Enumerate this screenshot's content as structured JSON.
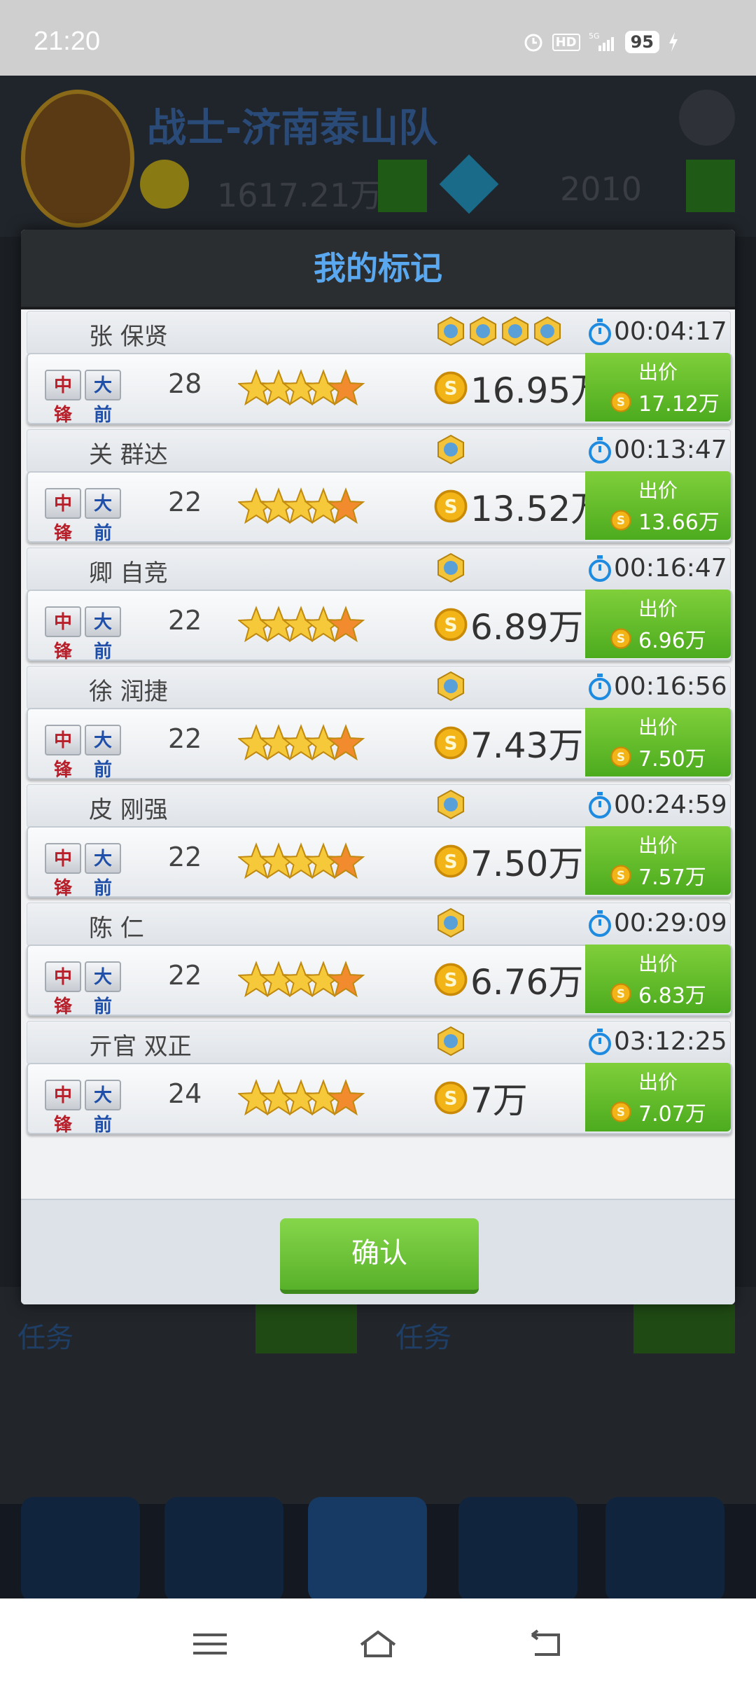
{
  "status_bar": {
    "time": "21:20",
    "battery": "95",
    "network": "5G",
    "hd": "HD"
  },
  "background": {
    "team_name": "战士-济南泰山队",
    "coins": "1617.21万",
    "gems": "2010",
    "panel_left_title": "任务",
    "panel_right_title": "任务"
  },
  "dialog": {
    "title": "我的标记",
    "confirm_label": "确认",
    "entries": [
      {
        "name": "张 保贤",
        "badge_count": 4,
        "timer": "00:04:17",
        "positions": [
          "中锋",
          "大前"
        ],
        "level": "28",
        "star_rating": 5,
        "price": "16.95万",
        "bid_label": "出价",
        "bid_price": "17.12万"
      },
      {
        "name": "关 群达",
        "badge_count": 1,
        "timer": "00:13:47",
        "positions": [
          "中锋",
          "大前"
        ],
        "level": "22",
        "star_rating": 5,
        "price": "13.52万",
        "bid_label": "出价",
        "bid_price": "13.66万"
      },
      {
        "name": "卿 自竞",
        "badge_count": 1,
        "timer": "00:16:47",
        "positions": [
          "中锋",
          "大前"
        ],
        "level": "22",
        "star_rating": 5,
        "price": "6.89万",
        "bid_label": "出价",
        "bid_price": "6.96万"
      },
      {
        "name": "徐 润捷",
        "badge_count": 1,
        "timer": "00:16:56",
        "positions": [
          "中锋",
          "大前"
        ],
        "level": "22",
        "star_rating": 5,
        "price": "7.43万",
        "bid_label": "出价",
        "bid_price": "7.50万"
      },
      {
        "name": "皮 刚强",
        "badge_count": 1,
        "timer": "00:24:59",
        "positions": [
          "中锋",
          "大前"
        ],
        "level": "22",
        "star_rating": 5,
        "price": "7.50万",
        "bid_label": "出价",
        "bid_price": "7.57万"
      },
      {
        "name": "陈 仁",
        "badge_count": 1,
        "timer": "00:29:09",
        "positions": [
          "中锋",
          "大前"
        ],
        "level": "22",
        "star_rating": 5,
        "price": "6.76万",
        "bid_label": "出价",
        "bid_price": "6.83万"
      },
      {
        "name": "亓官 双正",
        "badge_count": 1,
        "timer": "03:12:25",
        "positions": [
          "中锋",
          "大前"
        ],
        "level": "24",
        "star_rating": 5,
        "price": "7万",
        "bid_label": "出价",
        "bid_price": "7.07万"
      }
    ]
  },
  "colors": {
    "title": "#5aa8f0",
    "bid_green": "#58b12a",
    "center_red": "#b7202a",
    "forward_blue": "#1f4fa8",
    "coin_gold": "#f2b416"
  },
  "icons": [
    "alarm-icon",
    "signal-icon",
    "charging-icon",
    "coin-icon",
    "stopwatch-icon",
    "kg-badge-icon",
    "star-icon",
    "menu-icon",
    "home-icon",
    "back-icon",
    "gear-icon",
    "diamond-icon"
  ]
}
